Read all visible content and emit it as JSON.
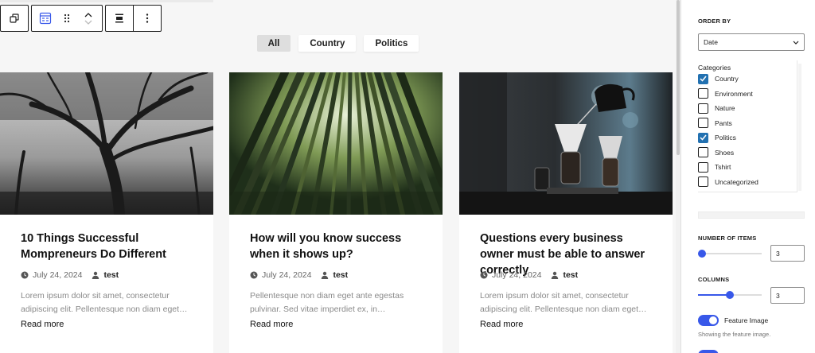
{
  "filters": [
    {
      "label": "All",
      "active": true
    },
    {
      "label": "Country",
      "active": false
    },
    {
      "label": "Politics",
      "active": false
    }
  ],
  "posts": [
    {
      "title": "10 Things Successful Mompreneurs Do Different",
      "date": "July 24, 2024",
      "author": "test",
      "excerpt": "Lorem ipsum dolor sit amet, consectetur adipiscing elit. Pellentesque non diam eget…",
      "read_more": "Read more"
    },
    {
      "title": "How will you know success when it shows up?",
      "date": "July 24, 2024",
      "author": "test",
      "excerpt": "Pellentesque non diam eget ante egestas pulvinar. Sed vitae imperdiet ex, in…",
      "read_more": "Read more"
    },
    {
      "title": "Questions every business owner must be able to answer correctly",
      "date": "July 24, 2024",
      "author": "test",
      "excerpt": "Lorem ipsum dolor sit amet, consectetur adipiscing elit. Pellentesque non diam eget…",
      "read_more": "Read more"
    }
  ],
  "sidebar": {
    "order_by_label": "ORDER BY",
    "order_by_value": "Date",
    "categories_label": "Categories",
    "categories": [
      {
        "label": "Country",
        "checked": true
      },
      {
        "label": "Environment",
        "checked": false
      },
      {
        "label": "Nature",
        "checked": false
      },
      {
        "label": "Pants",
        "checked": false
      },
      {
        "label": "Politics",
        "checked": true
      },
      {
        "label": "Shoes",
        "checked": false
      },
      {
        "label": "Tshirt",
        "checked": false
      },
      {
        "label": "Uncategorized",
        "checked": false
      }
    ],
    "number_of_items_label": "NUMBER OF ITEMS",
    "number_of_items_value": "3",
    "number_of_items_fraction": 0.0,
    "columns_label": "COLUMNS",
    "columns_value": "3",
    "columns_fraction": 0.5,
    "feature_image_label": "Feature Image",
    "feature_image_on": true,
    "feature_image_help": "Showing the feature image."
  },
  "colors": {
    "accent": "#3858e9",
    "checkbox": "#2271b1"
  }
}
